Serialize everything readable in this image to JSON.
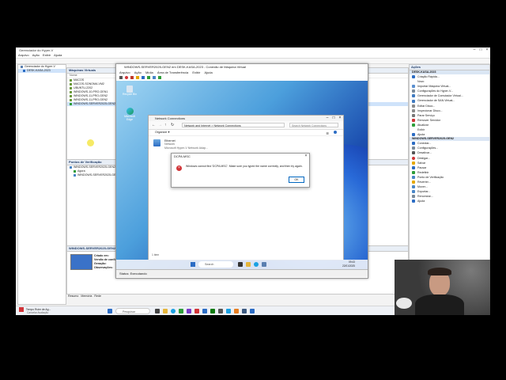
{
  "hyperv": {
    "title": "Gerenciador do Hyper-V",
    "menu": [
      "Arquivo",
      "Ação",
      "Exibir",
      "Ajuda"
    ],
    "tree": [
      "Gerenciador do Hyper-V",
      "DESK-KASA-2023"
    ],
    "vm_panel_title": "Máquinas Virtuais",
    "vm_col": "Nome",
    "vms": [
      "MACOS",
      "MACOS-SONOMA-VM2",
      "UBUNTU-2202",
      "WINDOWS-10-PRO-GEN1",
      "WINDOWS-11-PRO-GEN2",
      "WINDOWS-11-PRO-GEN2",
      "WINDOWS-SERVER2025-GEN2"
    ],
    "checkpoints_title": "Pontos de Verificação",
    "checkpoints": [
      "WINDOWS-SERVER2025-GEN2",
      "Agora",
      "WINDOWS-SERVER2025-GEN2"
    ],
    "details_title": "WINDOWS-SERVER2025-GEN2",
    "details": [
      "Criado em:",
      "Versão de config.",
      "Geração:",
      "Observações:"
    ],
    "details_tabs": [
      "Resumo",
      "Memória",
      "Rede"
    ]
  },
  "actions": {
    "title": "Ações",
    "host": "DESK-KASA-2023",
    "host_items": [
      "Criação Rápida...",
      "Novo",
      "Importar Máquina Virtual...",
      "Configurações do Hyper-V...",
      "Gerenciador de Comutador Virtual...",
      "Gerenciador de SAN Virtual...",
      "Editar Disco...",
      "Inspecionar Disco...",
      "Parar Serviço",
      "Remover Servidor",
      "Atualizar",
      "Exibir",
      "Ajuda"
    ],
    "vm": "WINDOWS-SERVER2025-GEN2",
    "vm_items": [
      "Conectar...",
      "Configurações...",
      "Desativar...",
      "Desligar...",
      "Salvar",
      "Pausar",
      "Redefinir",
      "Ponto de Verificação",
      "Reverter...",
      "Mover...",
      "Exportar...",
      "Renomear...",
      "Ajuda"
    ],
    "colors": {
      "green": "#2e9e3a",
      "blue": "#2b6cc4",
      "red": "#d13438",
      "yellow": "#e5a800"
    }
  },
  "vmconnect": {
    "title": "WINDOWS-SERVER2025-GEN2 em DESK-KASA-2023 - Conexão de Máquina Virtual",
    "menu": [
      "Arquivo",
      "Ação",
      "Mídia",
      "Área de Transferência",
      "Exibir",
      "Ajuda"
    ],
    "status": "Status: Executando",
    "desktop_icons": [
      "Recycle Bin",
      "Microsoft Edge"
    ],
    "taskbar_search": "Search",
    "clock_time": "09:43",
    "clock_date": "22/01/2025"
  },
  "explorer": {
    "title": "Network Connections",
    "breadcrumb": "Network and Internet  >  Network Connections",
    "search_placeholder": "Search Network Connections",
    "organize": "Organize ▾",
    "adapter_name": "Ethernet",
    "adapter_status": "Network",
    "adapter_desc": "Microsoft Hyper-V Network Adap...",
    "items_count": "1 item"
  },
  "dialog": {
    "title": "DCPA.MSC",
    "message": "Windows cannot find 'DCPA.MSC'. Make sure you typed the name correctly, and then try again.",
    "ok": "OK"
  },
  "host_taskbar": {
    "search": "Pesquisar",
    "notification_title": "Tempo Ruim de Ag...",
    "notification_sub": "Cancelar Avaliação"
  }
}
